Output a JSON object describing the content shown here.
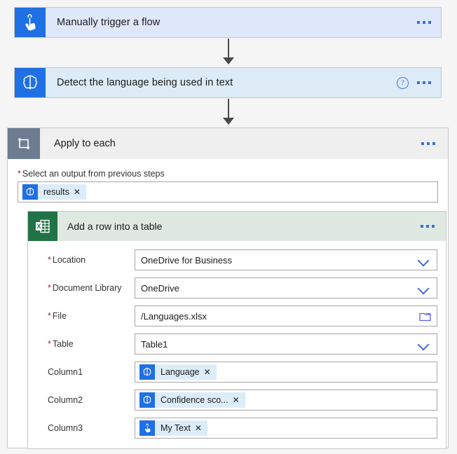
{
  "canvas": {
    "background": "#f5f5f5",
    "accent_blue": "#1f6fe5",
    "link_blue": "#3b6fd4",
    "excel_green": "#217346",
    "scope_gray": "#6e7c91",
    "required_red": "#a4262c"
  },
  "trigger": {
    "title": "Manually trigger a flow",
    "icon": "tap-hand-icon",
    "icon_bg": "#1f6fe5",
    "card_bg": "#dee8fa",
    "menu_label": "···"
  },
  "action_detect": {
    "title": "Detect the language being used in text",
    "icon": "brain-cognitive-services-icon",
    "icon_bg": "#1f6fe5",
    "card_bg": "#dcebf5",
    "help_label": "?",
    "menu_label": "···"
  },
  "scope": {
    "title": "Apply to each",
    "icon": "loop-repeat-icon",
    "icon_bg": "#6e7c91",
    "header_bg": "#efefef",
    "menu_label": "···",
    "output_field": {
      "required_mark": "*",
      "label": "Select an output from previous steps",
      "token": {
        "text": "results",
        "remove_label": "✕",
        "icon": "brain-cognitive-services-icon",
        "icon_bg": "#1f6fe5"
      }
    }
  },
  "excel_action": {
    "title": "Add a row into a table",
    "icon": "excel-icon",
    "icon_bg": "#217346",
    "header_bg": "#dfe9e1",
    "menu_label": "···",
    "fields": [
      {
        "name": "location",
        "required_mark": "*",
        "label": "Location",
        "type": "dropdown",
        "value": "OneDrive for Business",
        "trailing_icon": "chevron-down-icon"
      },
      {
        "name": "document-library",
        "required_mark": "*",
        "label": "Document Library",
        "type": "dropdown",
        "value": "OneDrive",
        "trailing_icon": "chevron-down-icon"
      },
      {
        "name": "file",
        "required_mark": "*",
        "label": "File",
        "type": "filepicker",
        "value": "/Languages.xlsx",
        "trailing_icon": "folder-icon"
      },
      {
        "name": "table",
        "required_mark": "*",
        "label": "Table",
        "type": "dropdown",
        "value": "Table1",
        "trailing_icon": "chevron-down-icon"
      }
    ],
    "columns": [
      {
        "name": "column1",
        "label": "Column1",
        "token": {
          "text": "Language",
          "remove_label": "✕",
          "icon": "brain-cognitive-services-icon",
          "icon_bg": "#1f6fe5"
        }
      },
      {
        "name": "column2",
        "label": "Column2",
        "token": {
          "text": "Confidence sco...",
          "remove_label": "✕",
          "icon": "brain-cognitive-services-icon",
          "icon_bg": "#1f6fe5"
        }
      },
      {
        "name": "column3",
        "label": "Column3",
        "token": {
          "text": "My Text",
          "remove_label": "✕",
          "icon": "tap-hand-icon",
          "icon_bg": "#1f6fe5"
        }
      }
    ]
  }
}
